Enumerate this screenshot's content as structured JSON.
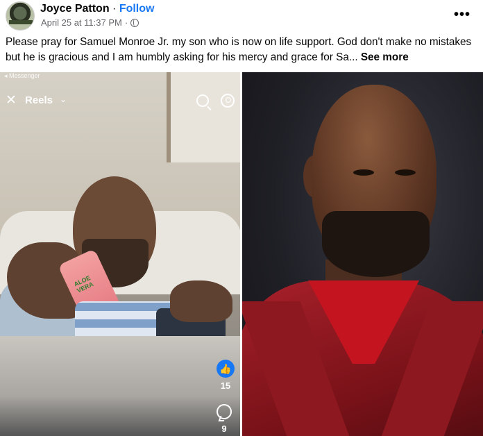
{
  "post": {
    "author": "Joyce Patton",
    "separator": " · ",
    "follow_label": "Follow",
    "timestamp": "April 25 at 11:37 PM",
    "meta_separator": "·",
    "more_label": "•••",
    "text": "Please pray for Samuel Monroe Jr. my son who is now on life support. God don't make no mistakes but he is gracious and I am humbly asking for his mercy and grace for Sa...",
    "see_more_label": "See more"
  },
  "reel": {
    "messenger_label": "◂ Messenger",
    "close_label": "✕",
    "title": "Reels",
    "chevron": "⌄",
    "bottle_label": "ALOE VERA",
    "like_count": "15",
    "comment_count": "9"
  },
  "icons": {
    "like": "thumbs-up-icon",
    "comment": "comment-icon",
    "search": "search-icon",
    "profile": "profile-icon",
    "globe": "globe-icon"
  },
  "colors": {
    "link": "#1877f2",
    "meta": "#65676b",
    "jacket": "#a8202a"
  }
}
